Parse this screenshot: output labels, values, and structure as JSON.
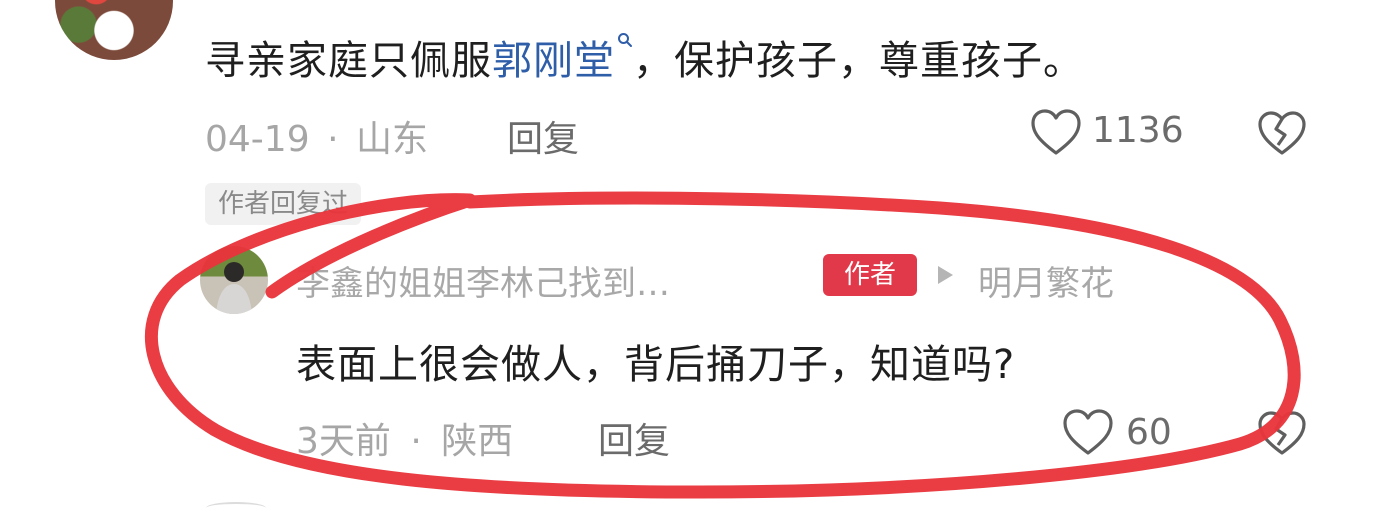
{
  "top_comment": {
    "text_before": "寻亲家庭只佩服",
    "link_text": "郭刚堂",
    "text_after": "，保护孩子，尊重孩子。",
    "date": "04-19",
    "separator": "·",
    "location": "山东",
    "reply_label": "回复",
    "like_count": "1136"
  },
  "author_replied_label": "作者回复过",
  "reply": {
    "username": "李鑫的姐姐李林己找到…",
    "author_tag": "作者",
    "reply_to": "明月繁花",
    "text": "表面上很会做人，背后捅刀子，知道吗?",
    "time": "3天前",
    "separator": "·",
    "location": "陕西",
    "reply_label": "回复",
    "like_count": "60"
  },
  "colors": {
    "link": "#2f5ea9",
    "author_tag_bg": "#e2394a",
    "annotation_stroke": "#e8343b"
  },
  "icons": [
    "search-icon",
    "heart-icon",
    "broken-heart-icon",
    "play-triangle-icon"
  ]
}
